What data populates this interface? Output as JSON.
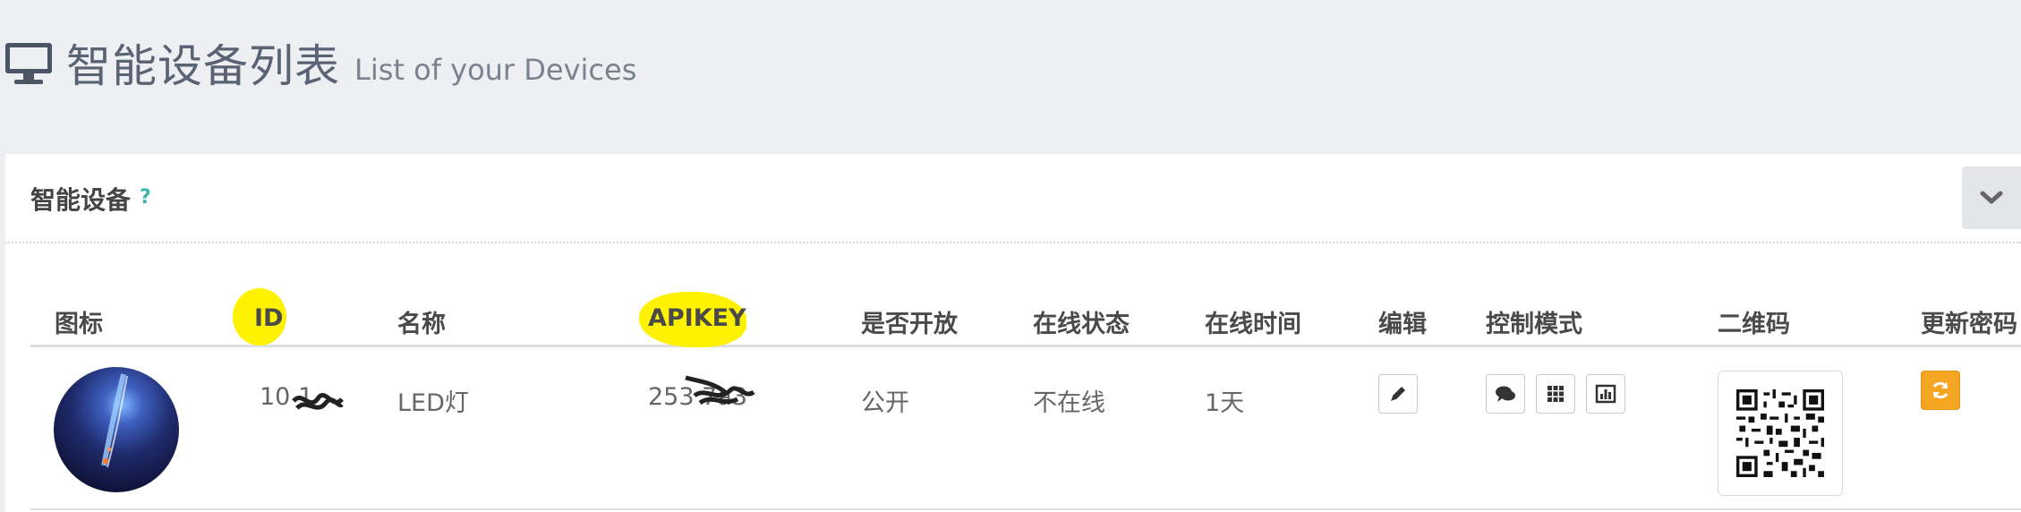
{
  "header": {
    "title": "智能设备列表",
    "subtitle": "List of your Devices",
    "icon": "monitor-icon"
  },
  "panel": {
    "title": "智能设备",
    "help": "?",
    "collapse_icon": "chevron-down-icon"
  },
  "table": {
    "columns": [
      "图标",
      "ID",
      "名称",
      "APIKEY",
      "是否开放",
      "在线状态",
      "在线时间",
      "编辑",
      "控制模式",
      "二维码",
      "更新密码"
    ],
    "highlight_color": "#fff200",
    "rows": [
      {
        "icon": "device-avatar",
        "id": "10   1",
        "name": "LED灯",
        "apikey": "253    7a3",
        "public": "公开",
        "status": "不在线",
        "online_time": "1天",
        "edit_icon": "pencil-icon",
        "control_icons": [
          "chat-icon",
          "grid-icon",
          "bar-chart-icon"
        ],
        "qr": "qr-code",
        "refresh_icon": "refresh-icon"
      }
    ]
  },
  "colors": {
    "accent_orange": "#f5a623",
    "help_teal": "#3fb6a8",
    "background": "#eeeff3"
  }
}
